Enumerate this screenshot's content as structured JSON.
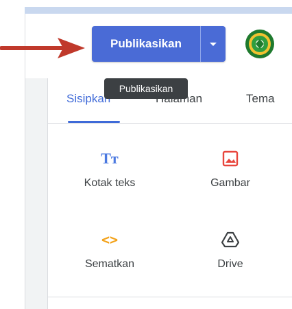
{
  "header": {
    "publish_label": "Publikasikan",
    "publish_tooltip": "Publikasikan",
    "accent_color": "#4a6bd6"
  },
  "icons": {
    "arrow": "red-arrow-icon",
    "dropdown": "chevron-down-icon",
    "logo": "organization-emblem-icon"
  },
  "tabs": [
    {
      "label": "Sisipkan",
      "active": true
    },
    {
      "label": "Halaman",
      "active": false
    },
    {
      "label": "Tema",
      "active": false
    }
  ],
  "insert_items": [
    {
      "icon_text": "Tт",
      "label": "Kotak teks",
      "icon": "text-box-icon"
    },
    {
      "label": "Gambar",
      "icon": "image-icon"
    },
    {
      "icon_text": "<>",
      "label": "Sematkan",
      "icon": "embed-code-icon"
    },
    {
      "label": "Drive",
      "icon": "drive-icon"
    }
  ]
}
